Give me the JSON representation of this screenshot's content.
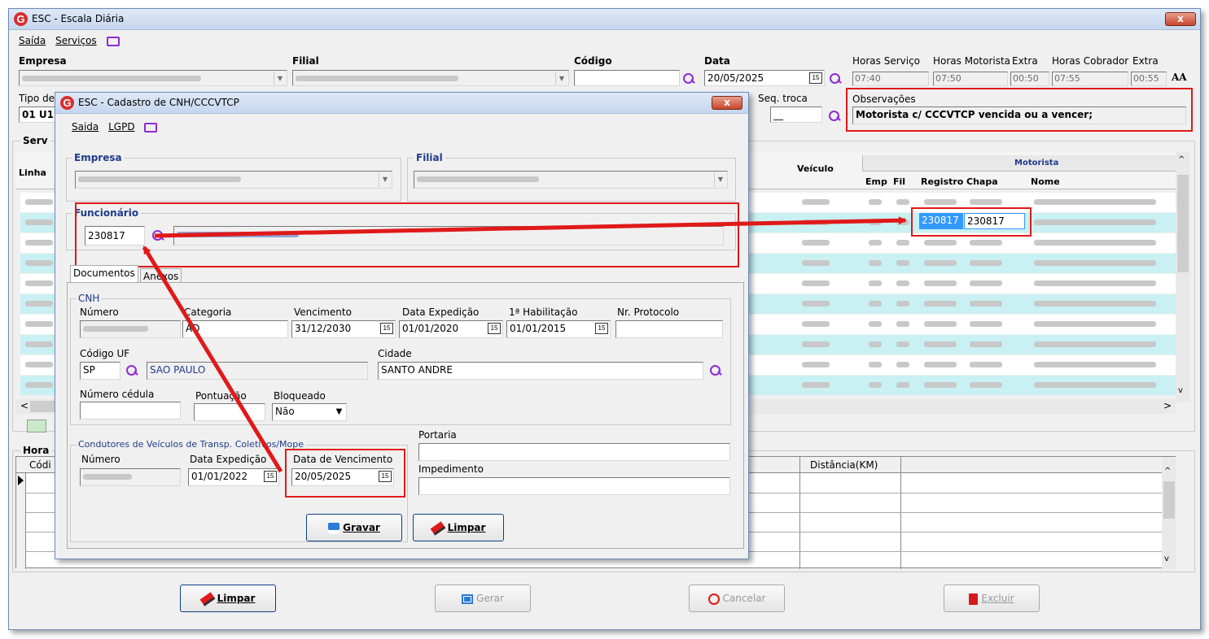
{
  "main": {
    "title": "ESC - Escala Diária",
    "logo": "G",
    "close": "x",
    "menu": [
      "Saída",
      "Serviços"
    ],
    "labels": {
      "empresa": "Empresa",
      "filial": "Filial",
      "codigo": "Código",
      "data": "Data",
      "horas_servico": "Horas Serviço",
      "horas_motorista": "Horas Motorista",
      "extra": "Extra",
      "horas_cobrador": "Horas Cobrador",
      "extra2": "Extra",
      "tipo": "Tipo de",
      "seq_troca": "Seq. troca",
      "observacoes": "Observações",
      "serv": "Serv",
      "linha": "Linha",
      "hora": "Hora",
      "codi": "Códi",
      "font_size_btn": "AA"
    },
    "values": {
      "data": "20/05/2025",
      "horas_servico": "07:40",
      "horas_motorista": "07:50",
      "extra": "00:50",
      "horas_cobrador": "07:55",
      "extra2": "00:55",
      "tipo": "01 U1",
      "seq_troca": "__",
      "observacoes": "Motorista c/ CCCVTCP vencida ou a vencer;",
      "cal": "15"
    },
    "grid": {
      "veiculo": "Veículo",
      "motorista": "Motorista",
      "emp": "Emp",
      "fil": "Fil",
      "registro": "Registro",
      "chapa": "Chapa",
      "nome": "Nome",
      "selected_registro": "230817",
      "selected_chapa": "230817"
    },
    "lower_grid": {
      "distancia": "Distância(KM)"
    },
    "buttons": {
      "limpar": "Limpar",
      "gerar": "Gerar",
      "cancelar": "Cancelar",
      "excluir": "Excluir"
    },
    "scroll": {
      "left": "<",
      "right": ">",
      "up": "^",
      "down": "v"
    }
  },
  "dialog": {
    "title": "ESC - Cadastro de CNH/CCCVTCP",
    "logo": "G",
    "close": "x",
    "menu": [
      "Saida",
      "LGPD"
    ],
    "empresa_label": "Empresa",
    "filial_label": "Filial",
    "funcionario_label": "Funcionário",
    "funcionario_value": "230817",
    "tabs": [
      "Documentos",
      "Anexos"
    ],
    "cnh": {
      "group": "CNH",
      "numero_label": "Número",
      "categoria_label": "Categoria",
      "categoria_value": "AD",
      "vencimento_label": "Vencimento",
      "vencimento_value": "31/12/2030",
      "expedicao_label": "Data Expedição",
      "expedicao_value": "01/01/2020",
      "habilitacao_label": "1ª Habilitação",
      "habilitacao_value": "01/01/2015",
      "protocolo_label": "Nr. Protocolo",
      "uf_label": "Código UF",
      "uf_value": "SP",
      "uf_name": "SAO PAULO",
      "cidade_label": "Cidade",
      "cidade_value": "SANTO ANDRE",
      "cedula_label": "Número cédula",
      "pontuacao_label": "Pontuação",
      "bloqueado_label": "Bloqueado",
      "bloqueado_value": "Não"
    },
    "cccvtcp": {
      "group": "Condutores de Veículos de Transp. Coletivos/Mope",
      "numero_label": "Número",
      "expedicao_label": "Data Expedição",
      "expedicao_value": "01/01/2022",
      "vencimento_label": "Data de Vencimento",
      "vencimento_value": "20/05/2025"
    },
    "portaria_label": "Portaria",
    "impedimento_label": "Impedimento",
    "buttons": {
      "gravar": "Gravar",
      "limpar": "Limpar"
    }
  },
  "colors": {
    "accent_red": "#e01919",
    "selection_blue": "#3399ff",
    "row_cyan": "#c9f0f2",
    "magnifier": "#8f2bd1"
  }
}
